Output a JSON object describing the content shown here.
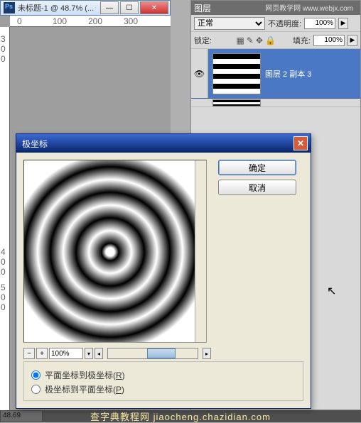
{
  "doc": {
    "title": "未标题-1 @ 48.7% (...",
    "ruler_h": [
      "0",
      "100",
      "200",
      "300"
    ],
    "ruler_v": [
      "3 0 0",
      "4 0 0",
      "5 0 0"
    ],
    "status_zoom": "48.69"
  },
  "layers": {
    "tab": "图层",
    "watermark": "网页教学网  www.webjx.com",
    "opacity_label": "不透明度:",
    "opacity_value": "100%",
    "fill_label": "填充:",
    "fill_value": "100%",
    "lock_label": "锁定:",
    "blend_mode": "正常",
    "layer_name": "图层 2 副本 3"
  },
  "dialog": {
    "title": "极坐标",
    "ok": "确定",
    "cancel": "取消",
    "zoom": "100%",
    "radio1_pre": "平面坐标到极坐标(",
    "radio1_key": "R",
    "radio1_post": ")",
    "radio2_pre": "极坐标到平面坐标(",
    "radio2_key": "P",
    "radio2_post": ")"
  },
  "footer": "查字典教程网 jiaocheng.chazidian.com"
}
